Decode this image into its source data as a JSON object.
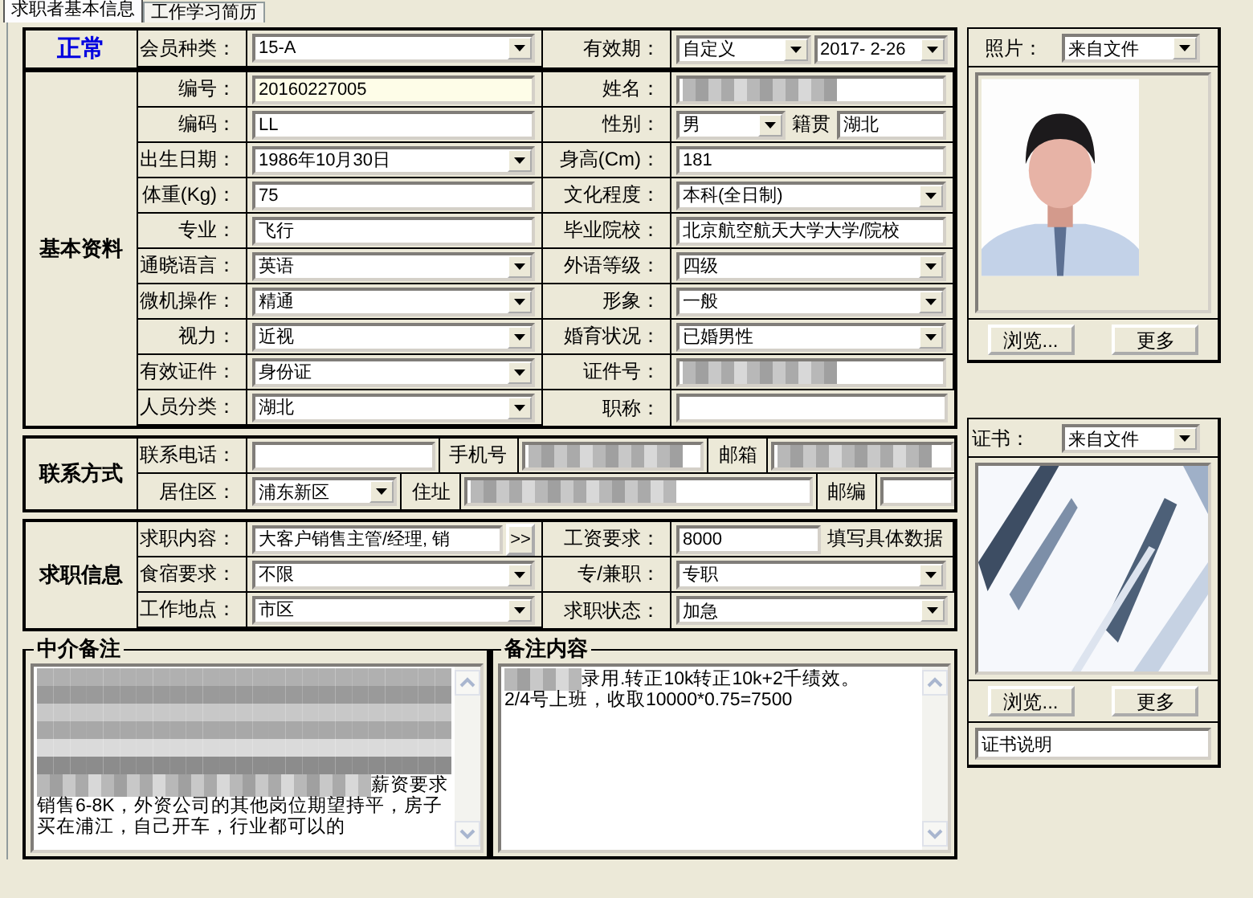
{
  "tabs": [
    {
      "label": "求职者基本信息",
      "selected": true
    },
    {
      "label": "工作学习简历",
      "selected": false
    }
  ],
  "header": {
    "status": "正常",
    "cells": [
      {
        "label": "会员种类：",
        "controls": [
          {
            "kind": "select",
            "value": "15-A"
          }
        ]
      },
      {
        "label": "有效期：",
        "controls": [
          {
            "kind": "select",
            "value": "自定义"
          },
          {
            "kind": "select",
            "value": "2017- 2-26"
          }
        ]
      }
    ]
  },
  "sections": [
    {
      "title": "基本资料",
      "rows": [
        [
          {
            "label": "编号：",
            "controls": [
              {
                "kind": "highlighted_text",
                "value": "20160227005"
              }
            ]
          },
          {
            "label": "姓名：",
            "controls": [
              {
                "kind": "redacted"
              }
            ]
          }
        ],
        [
          {
            "label": "编码：",
            "controls": [
              {
                "kind": "text",
                "value": "LL"
              }
            ]
          },
          {
            "label": "性别：",
            "controls": [
              {
                "kind": "select",
                "value": "男"
              },
              {
                "kind": "note",
                "value": "籍贯"
              },
              {
                "kind": "text",
                "value": "湖北"
              }
            ]
          }
        ],
        [
          {
            "label": "出生日期：",
            "controls": [
              {
                "kind": "select",
                "value": "1986年10月30日"
              }
            ]
          },
          {
            "label": "身高(Cm)：",
            "controls": [
              {
                "kind": "text",
                "value": "181"
              }
            ]
          }
        ],
        [
          {
            "label": "体重(Kg)：",
            "controls": [
              {
                "kind": "text",
                "value": "75"
              }
            ]
          },
          {
            "label": "文化程度：",
            "controls": [
              {
                "kind": "select",
                "value": "本科(全日制)"
              }
            ]
          }
        ],
        [
          {
            "label": "专业：",
            "controls": [
              {
                "kind": "text",
                "value": "飞行"
              }
            ]
          },
          {
            "label": "毕业院校：",
            "controls": [
              {
                "kind": "text",
                "value": "北京航空航天大学大学/院校"
              }
            ]
          }
        ],
        [
          {
            "label": "通晓语言：",
            "controls": [
              {
                "kind": "select",
                "value": "英语"
              }
            ]
          },
          {
            "label": "外语等级：",
            "controls": [
              {
                "kind": "select",
                "value": "四级"
              }
            ]
          }
        ],
        [
          {
            "label": "微机操作：",
            "controls": [
              {
                "kind": "select",
                "value": "精通"
              }
            ]
          },
          {
            "label": "形象：",
            "controls": [
              {
                "kind": "select",
                "value": "一般"
              }
            ]
          }
        ],
        [
          {
            "label": "视力：",
            "controls": [
              {
                "kind": "select",
                "value": "近视"
              }
            ]
          },
          {
            "label": "婚育状况：",
            "controls": [
              {
                "kind": "select",
                "value": "已婚男性"
              }
            ]
          }
        ],
        [
          {
            "label": "有效证件：",
            "controls": [
              {
                "kind": "select",
                "value": "身份证"
              }
            ]
          },
          {
            "label": "证件号：",
            "controls": [
              {
                "kind": "redacted"
              }
            ]
          }
        ],
        [
          {
            "label": "人员分类：",
            "controls": [
              {
                "kind": "select",
                "value": "湖北"
              }
            ]
          },
          {
            "label": "职称：",
            "controls": [
              {
                "kind": "text"
              }
            ]
          }
        ]
      ]
    },
    {
      "title": "联系方式",
      "rows": [
        [
          {
            "label": "联系电话：",
            "controls": [
              {
                "kind": "text"
              },
              {
                "kind": "label",
                "value": "手机号"
              },
              {
                "kind": "redacted"
              },
              {
                "kind": "label",
                "value": "邮箱"
              },
              {
                "kind": "redacted"
              }
            ]
          }
        ],
        [
          {
            "label": "居住区：",
            "controls": [
              {
                "kind": "select",
                "value": "浦东新区"
              },
              {
                "kind": "label",
                "value": "住址"
              },
              {
                "kind": "wide_redacted"
              },
              {
                "kind": "label",
                "value": "邮编"
              },
              {
                "kind": "short_text"
              }
            ]
          }
        ]
      ]
    },
    {
      "title": "求职信息",
      "rows": [
        [
          {
            "label": "求职内容：",
            "controls": [
              {
                "kind": "text",
                "value": "大客户销售主管/经理, 销"
              },
              {
                "kind": "button",
                "value": ">>"
              }
            ]
          },
          {
            "label": "工资要求：",
            "controls": [
              {
                "kind": "text",
                "value": "8000"
              },
              {
                "kind": "note",
                "value": "填写具体数据"
              }
            ]
          }
        ],
        [
          {
            "label": "食宿要求：",
            "controls": [
              {
                "kind": "select",
                "value": "不限"
              }
            ]
          },
          {
            "label": "专/兼职：",
            "controls": [
              {
                "kind": "select",
                "value": "专职"
              }
            ]
          }
        ],
        [
          {
            "label": "工作地点：",
            "controls": [
              {
                "kind": "select",
                "value": "市区"
              }
            ]
          },
          {
            "label": "求职状态：",
            "controls": [
              {
                "kind": "select",
                "value": "加急"
              }
            ]
          }
        ]
      ]
    }
  ],
  "notes": [
    {
      "title": "中介备注",
      "redacted": true,
      "lines": [
        {
          "redacted_prefix": true,
          "text": "薪资要求"
        },
        {
          "redacted_prefix": false,
          "text": "销售6-8K，外资公司的其他岗位期望持平，房子"
        },
        {
          "redacted_prefix": false,
          "text": "买在浦江，自己开车，行业都可以的"
        }
      ]
    },
    {
      "title": "备注内容",
      "redacted": false,
      "lines": [
        {
          "redacted_prefix": true,
          "text": "录用.转正10k转正10k+2千绩效。"
        },
        {
          "redacted_prefix": false,
          "text": "2/4号上班，收取10000*0.75=7500"
        }
      ]
    }
  ],
  "photo": {
    "label": "照片：",
    "source": "来自文件",
    "buttons": [
      "浏览...",
      "更多"
    ]
  },
  "certificate": {
    "label": "证书：",
    "source": "来自文件",
    "buttons": [
      "浏览...",
      "更多"
    ],
    "caption": "证书说明"
  }
}
